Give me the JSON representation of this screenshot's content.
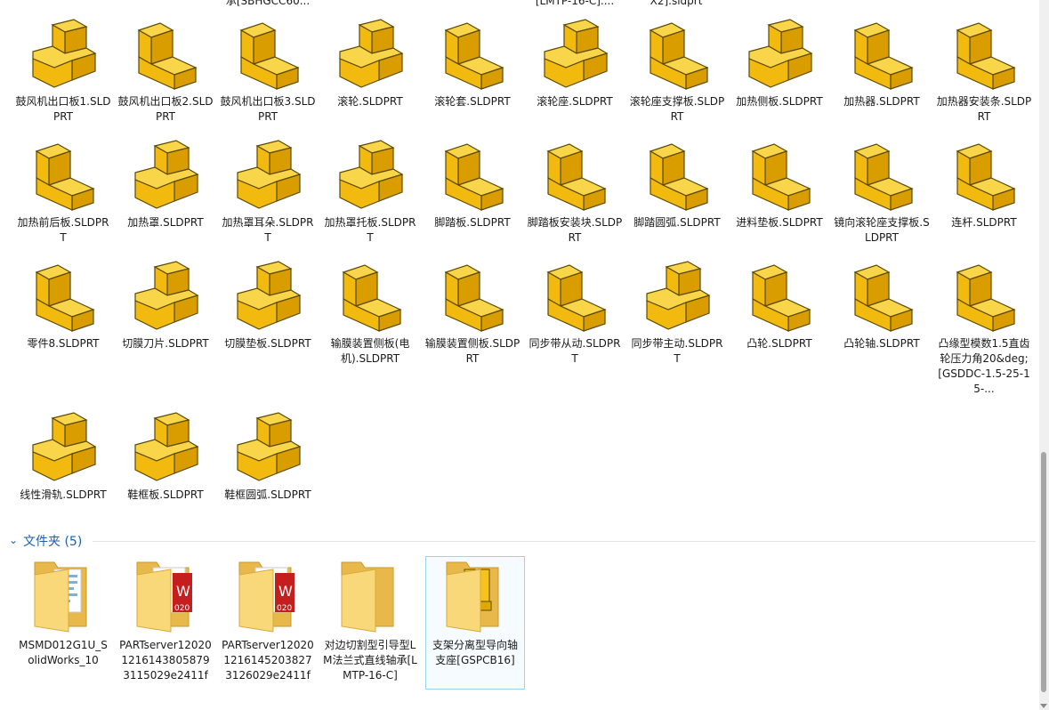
{
  "partial_top_labels": [
    "承[SBHGCC60...",
    "[LMTP-16-C]....",
    "X2].sldprt"
  ],
  "parts": [
    {
      "label": "鼓风机出口板1.SLDPRT"
    },
    {
      "label": "鼓风机出口板2.SLDPRT"
    },
    {
      "label": "鼓风机出口板3.SLDPRT"
    },
    {
      "label": "滚轮.SLDPRT"
    },
    {
      "label": "滚轮套.SLDPRT"
    },
    {
      "label": "滚轮座.SLDPRT"
    },
    {
      "label": "滚轮座支撑板.SLDPRT"
    },
    {
      "label": "加热侧板.SLDPRT"
    },
    {
      "label": "加热器.SLDPRT"
    },
    {
      "label": "加热器安装条.SLDPRT"
    },
    {
      "label": "加热前后板.SLDPRT"
    },
    {
      "label": "加热罩.SLDPRT"
    },
    {
      "label": "加热罩耳朵.SLDPRT"
    },
    {
      "label": "加热罩托板.SLDPRT"
    },
    {
      "label": "脚踏板.SLDPRT"
    },
    {
      "label": "脚踏板安装块.SLDPRT"
    },
    {
      "label": "脚踏圆弧.SLDPRT"
    },
    {
      "label": "进料垫板.SLDPRT"
    },
    {
      "label": "镜向滚轮座支撑板.SLDPRT"
    },
    {
      "label": "连杆.SLDPRT"
    },
    {
      "label": "零件8.SLDPRT"
    },
    {
      "label": "切膜刀片.SLDPRT"
    },
    {
      "label": "切膜垫板.SLDPRT"
    },
    {
      "label": "输膜装置侧板(电机).SLDPRT"
    },
    {
      "label": "输膜装置侧板.SLDPRT"
    },
    {
      "label": "同步带从动.SLDPRT"
    },
    {
      "label": "同步带主动.SLDPRT"
    },
    {
      "label": "凸轮.SLDPRT"
    },
    {
      "label": "凸轮轴.SLDPRT"
    },
    {
      "label": "凸缘型模数1.5直齿轮压力角20&deg;[GSDDC-1.5-25-15-..."
    },
    {
      "label": "线性滑轨.SLDPRT"
    },
    {
      "label": "鞋框板.SLDPRT"
    },
    {
      "label": "鞋框圆弧.SLDPRT"
    }
  ],
  "folders_group": {
    "title": "文件夹 (5)"
  },
  "folders": [
    {
      "label": "MSMD012G1U_SolidWorks_10",
      "kind": "folder-doc"
    },
    {
      "label": "PARTserver1202012161438058793115029e2411f",
      "kind": "folder-sw"
    },
    {
      "label": "PARTserver1202012161452038273126029e2411f",
      "kind": "folder-sw"
    },
    {
      "label": "对边切割型引导型LM法兰式直线轴承[LMTP-16-C]",
      "kind": "folder-plain"
    },
    {
      "label": "支架分离型导向轴支座[GSPCB16]",
      "kind": "folder-part",
      "selected": true
    }
  ],
  "colors": {
    "part_fill": "#f6c21c",
    "part_shade": "#e0a800",
    "folder": "#f5d26b",
    "accent": "#1e5fa8"
  }
}
